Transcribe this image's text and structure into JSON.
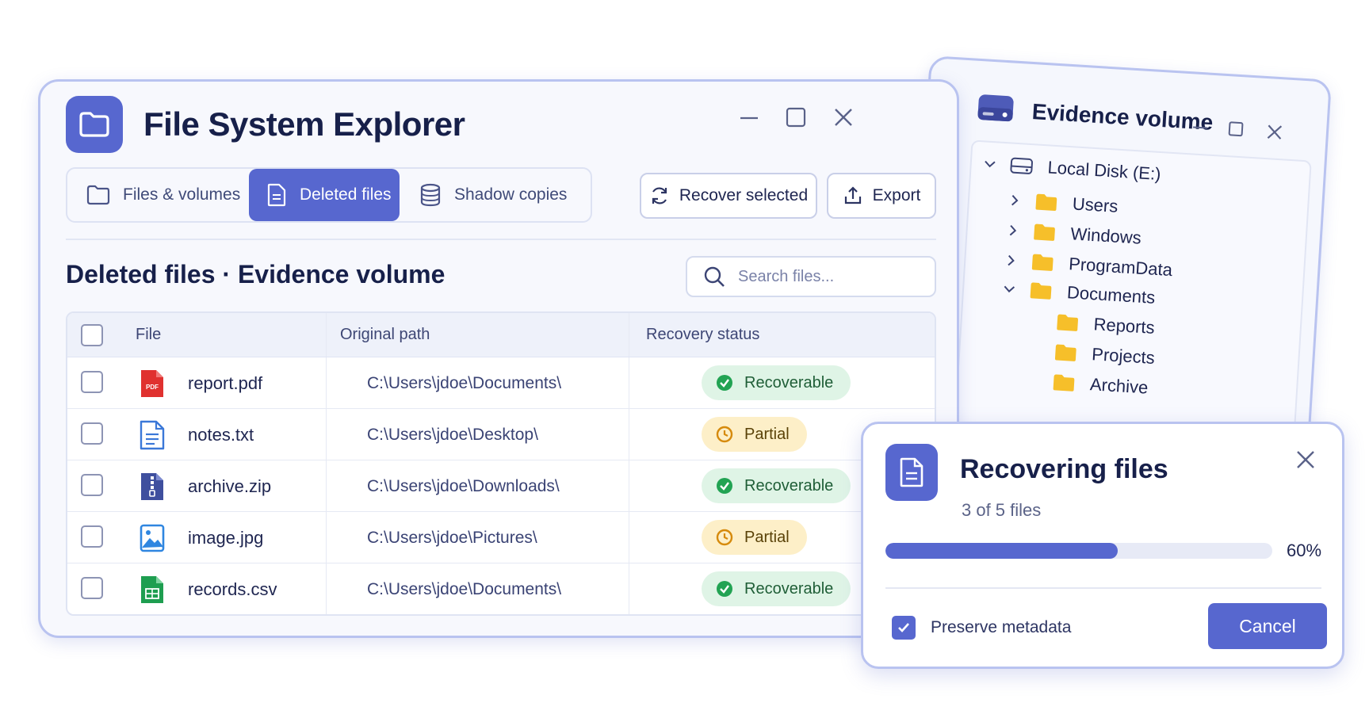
{
  "app": {
    "title": "File System Explorer"
  },
  "tabs": [
    {
      "label": "Files & volumes",
      "icon": "folder-icon",
      "active": false
    },
    {
      "label": "Deleted files",
      "icon": "document-icon",
      "active": true
    },
    {
      "label": "Shadow copies",
      "icon": "database-icon",
      "active": false
    }
  ],
  "toolbar": {
    "recover_label": "Recover selected",
    "export_label": "Export"
  },
  "section": {
    "title": "Deleted files · Evidence volume"
  },
  "search": {
    "placeholder": "Search files..."
  },
  "table": {
    "columns": [
      "File",
      "Original path",
      "Recovery status"
    ],
    "rows": [
      {
        "file": "report.pdf",
        "icon": "pdf-file-icon",
        "path": "C:\\Users\\jdoe\\Documents\\",
        "status": "Recoverable",
        "status_kind": "ok"
      },
      {
        "file": "notes.txt",
        "icon": "text-file-icon",
        "path": "C:\\Users\\jdoe\\Desktop\\",
        "status": "Partial",
        "status_kind": "partial"
      },
      {
        "file": "archive.zip",
        "icon": "zip-file-icon",
        "path": "C:\\Users\\jdoe\\Downloads\\",
        "status": "Recoverable",
        "status_kind": "ok"
      },
      {
        "file": "image.jpg",
        "icon": "image-file-icon",
        "path": "C:\\Users\\jdoe\\Pictures\\",
        "status": "Partial",
        "status_kind": "partial"
      },
      {
        "file": "records.csv",
        "icon": "spreadsheet-file-icon",
        "path": "C:\\Users\\jdoe\\Documents\\",
        "status": "Recoverable",
        "status_kind": "ok"
      }
    ]
  },
  "evidence_window": {
    "title": "Evidence volume",
    "tree": [
      {
        "label": "Local Disk (E:)",
        "icon": "drive-icon",
        "expanded": true
      },
      {
        "label": "Users",
        "icon": "folder-icon",
        "expanded": false
      },
      {
        "label": "Windows",
        "icon": "folder-icon",
        "expanded": false
      },
      {
        "label": "ProgramData",
        "icon": "folder-icon",
        "expanded": false
      },
      {
        "label": "Documents",
        "icon": "folder-icon",
        "expanded": true
      },
      {
        "label": "Reports",
        "icon": "folder-icon"
      },
      {
        "label": "Projects",
        "icon": "folder-icon"
      },
      {
        "label": "Archive",
        "icon": "folder-icon"
      }
    ]
  },
  "dialog": {
    "title": "Recovering files",
    "subtitle": "3 of 5 files",
    "progress": 0.6,
    "progress_label": "60%",
    "preserve_label": "Preserve metadata",
    "preserve_checked": true,
    "cancel_label": "Cancel"
  },
  "colors": {
    "accent": "#5767cf",
    "ok_bg": "#dff4e6",
    "ok_icon": "#22a353",
    "partial_bg": "#fdefc8",
    "partial_icon": "#d68a0c",
    "folder": "#f6bf2a"
  }
}
